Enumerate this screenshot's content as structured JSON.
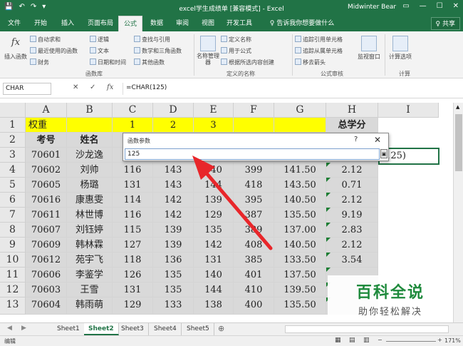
{
  "window": {
    "title": "excel学生成绩单  [兼容模式] - Excel",
    "user": "Midwinter Bear",
    "controls": [
      "▭",
      "—",
      "☐",
      "✕"
    ]
  },
  "ribbon_tabs": [
    {
      "label": "文件"
    },
    {
      "label": "开始"
    },
    {
      "label": "插入"
    },
    {
      "label": "页面布局"
    },
    {
      "label": "公式"
    },
    {
      "label": "数据"
    },
    {
      "label": "审阅"
    },
    {
      "label": "视图"
    },
    {
      "label": "开发工具"
    },
    {
      "label": "♀ 告诉我你想要做什么"
    }
  ],
  "share_label": "♀ 共享",
  "ribbon": {
    "insert_function": "插入函数",
    "autosum": "自动求和",
    "recent": "最近使用的函数",
    "financial": "财务",
    "logical": "逻辑",
    "text": "文本",
    "datetime": "日期和时间",
    "lookup": "查找与引用",
    "math": "数学和三角函数",
    "other": "其他函数",
    "name_manager": "名称管理器",
    "define_name": "定义名称",
    "use_in_formula": "用于公式",
    "create_from_sel": "根据所选内容创建",
    "trace_precedents": "追踪引用单元格",
    "trace_dependents": "追踪从属单元格",
    "remove_arrows": "移去箭头",
    "watch_window": "监视窗口",
    "calc_options": "计算选项",
    "group_library": "函数库",
    "group_names": "定义的名称",
    "group_audit": "公式审核",
    "group_calc": "计算"
  },
  "formula_bar": {
    "name_box": "CHAR",
    "formula": "=CHAR(125)"
  },
  "columns": [
    "A",
    "B",
    "C",
    "D",
    "E",
    "F",
    "G",
    "H",
    "I"
  ],
  "rows": [
    "1",
    "2",
    "3",
    "4",
    "5",
    "6",
    "7",
    "8",
    "9",
    "10",
    "11",
    "12",
    "13"
  ],
  "sheet": {
    "r1": [
      "权重",
      "",
      "1",
      "2",
      "3",
      "",
      "",
      "总学分"
    ],
    "r2": [
      "考号",
      "姓名"
    ],
    "data": [
      [
        "70601",
        "沙龙逸",
        "",
        "",
        "",
        "",
        "",
        ""
      ],
      [
        "70602",
        "刘帅",
        "116",
        "143",
        "140",
        "399",
        "141.50",
        "2.12"
      ],
      [
        "70605",
        "杨璐",
        "131",
        "143",
        "144",
        "418",
        "143.50",
        "0.71"
      ],
      [
        "70616",
        "康惠雯",
        "114",
        "142",
        "139",
        "395",
        "140.50",
        "2.12"
      ],
      [
        "70611",
        "林世博",
        "116",
        "142",
        "129",
        "387",
        "135.50",
        "9.19"
      ],
      [
        "70607",
        "刘钰婷",
        "115",
        "139",
        "135",
        "389",
        "137.00",
        "2.83"
      ],
      [
        "70609",
        "韩林霖",
        "127",
        "139",
        "142",
        "408",
        "140.50",
        "2.12"
      ],
      [
        "70612",
        "苑宇飞",
        "118",
        "136",
        "131",
        "385",
        "133.50",
        "3.54"
      ],
      [
        "70606",
        "李鉴学",
        "126",
        "135",
        "140",
        "401",
        "137.50",
        ""
      ],
      [
        "70603",
        "王雪",
        "131",
        "135",
        "144",
        "410",
        "139.50",
        ""
      ],
      [
        "70604",
        "韩雨萌",
        "129",
        "133",
        "138",
        "400",
        "135.50",
        ""
      ]
    ],
    "active_cell_text": "(125)"
  },
  "dialog": {
    "title": "函数参数",
    "help": "?",
    "close": "✕",
    "input": "125"
  },
  "sheet_tabs": [
    "Sheet1",
    "Sheet2",
    "Sheet3",
    "Sheet4",
    "Sheet5"
  ],
  "active_sheet": "Sheet2",
  "status": {
    "mode": "编辑",
    "zoom": "171%"
  },
  "watermark": {
    "line1": "百科全说",
    "line2": "助你轻松解决"
  }
}
